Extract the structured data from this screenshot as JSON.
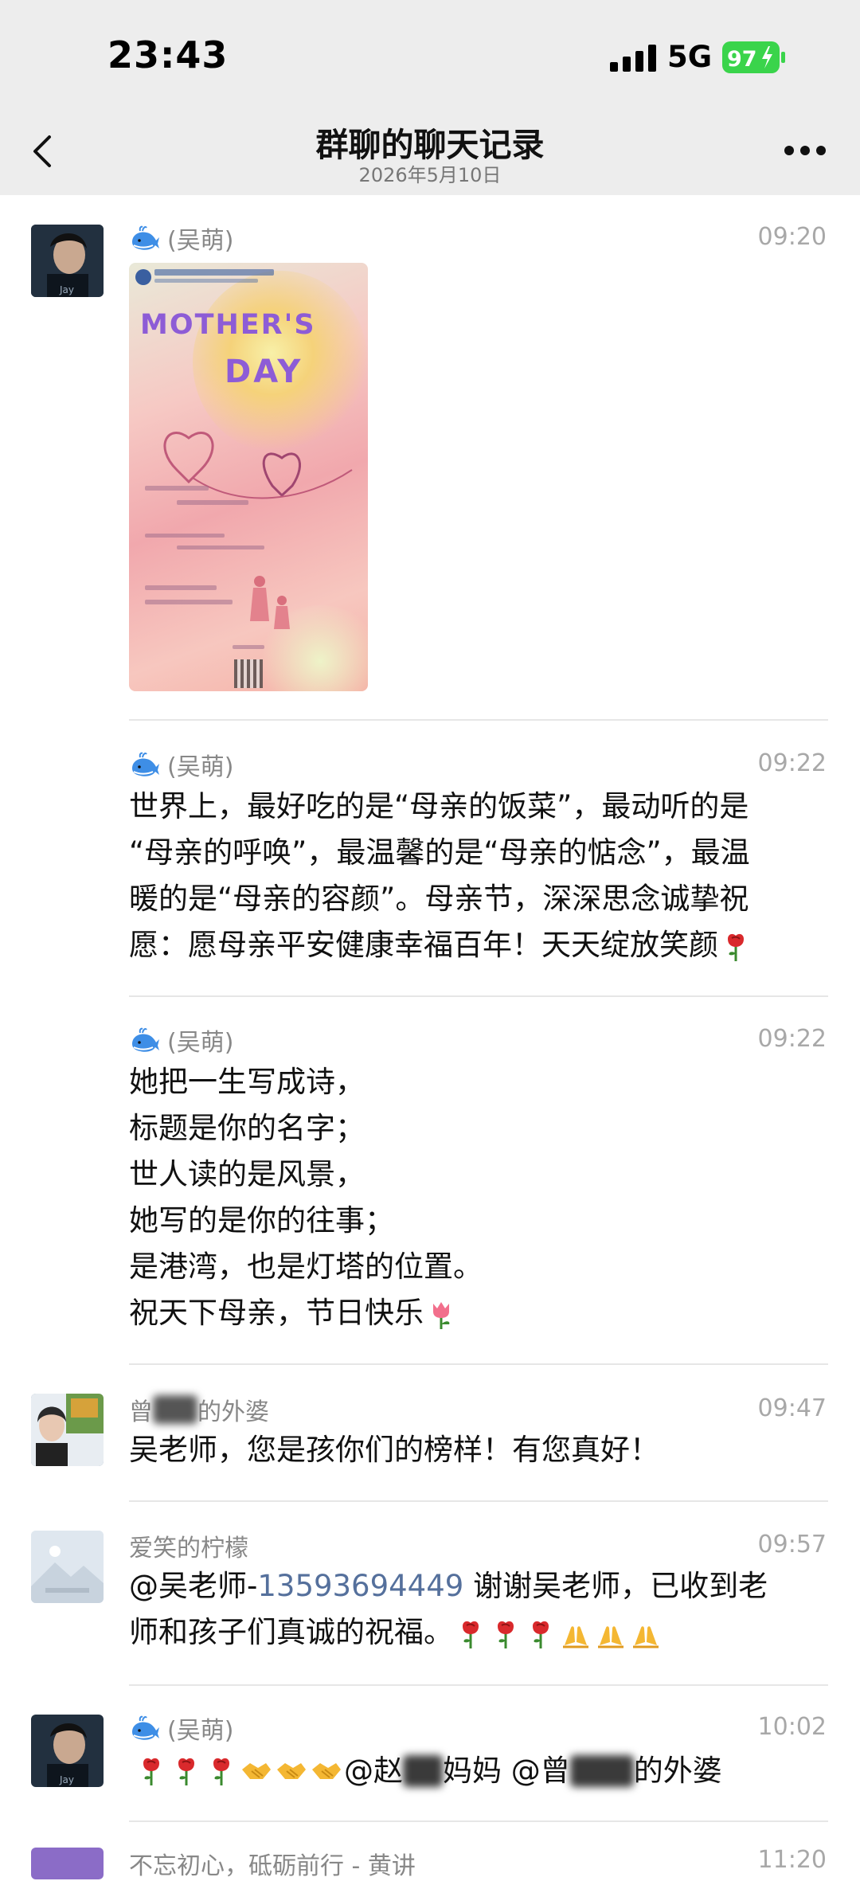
{
  "status_bar": {
    "time": "23:43",
    "network": "5G",
    "battery": "97"
  },
  "header": {
    "title": "群聊的聊天记录",
    "date": "2026年5月10日"
  },
  "messages": [
    {
      "sender": "(吴萌)",
      "time": "09:20",
      "type": "image",
      "image": {
        "line1": "MOTHER'S",
        "line2": "DAY"
      }
    },
    {
      "sender": "(吴萌)",
      "time": "09:22",
      "type": "text",
      "lines": [
        "世界上，最好吃的是“母亲的饭菜”，最动听的是",
        "“母亲的呼唤”，最温馨的是“母亲的惦念”，最温",
        "暖的是“母亲的容颜”。母亲节，深深思念诚挚祝",
        "愿：愿母亲平安健康幸福百年！天天绽放笑颜"
      ]
    },
    {
      "sender": "(吴萌)",
      "time": "09:22",
      "type": "text",
      "lines": [
        "她把一生写成诗，",
        "标题是你的名字；",
        "世人读的是风景，",
        "她写的是你的往事；",
        "是港湾，也是灯塔的位置。",
        "祝天下母亲，节日快乐"
      ]
    },
    {
      "sender_prefix": "曾",
      "sender_suffix": "的外婆",
      "time": "09:47",
      "type": "text",
      "lines": [
        "吴老师，您是孩你们的榜样！有您真好！"
      ]
    },
    {
      "sender": "爱笑的柠檬",
      "time": "09:57",
      "type": "text",
      "mention": "@吴老师-",
      "phone": "13593694449",
      "line1_rest": " 谢谢吴老师，已收到老",
      "line2": "师和孩子们真诚的祝福。"
    },
    {
      "sender": "(吴萌)",
      "time": "10:02",
      "type": "text",
      "mention1": "@赵",
      "mention1_suffix": "妈妈 @曾",
      "mention2_suffix": "的外婆"
    },
    {
      "sender": "不忘初心，砥砺前行 - 黄讲",
      "time": "11:20"
    }
  ],
  "icons": {
    "back": "chevron-left-icon",
    "more": "ellipsis-icon",
    "whale": "whale-emoji",
    "rose": "rose-emoji",
    "tulip": "tulip-emoji",
    "pray": "pray-emoji",
    "handshake": "handshake-emoji"
  },
  "colors": {
    "header_bg": "#ededed",
    "battery": "#3ad44b",
    "phone_link": "#55709c"
  }
}
